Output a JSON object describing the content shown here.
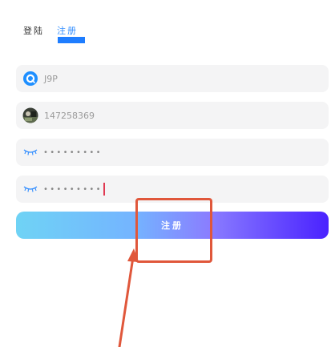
{
  "tabs": {
    "login_label": "登陆",
    "register_label": "注册"
  },
  "fields": {
    "username_value": "J9P",
    "phone_value": "147258369",
    "password_mask": "•••••••••",
    "confirm_password_mask": "•••••••••"
  },
  "submit": {
    "label": "注册"
  },
  "colors": {
    "accent": "#1e7dff",
    "annotation": "#e0573b",
    "cursor": "#e03a52"
  },
  "icons": {
    "username": "circular-app-logo-icon",
    "phone": "avatar-photo-icon",
    "password": "closed-eye-icon",
    "confirm_password": "closed-eye-icon"
  }
}
